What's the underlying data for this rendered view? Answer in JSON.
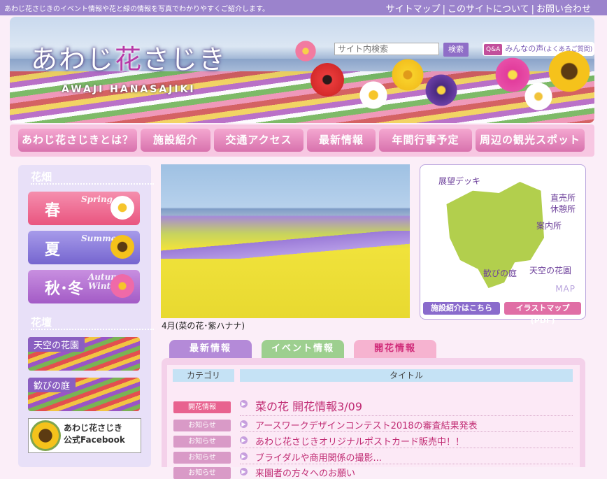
{
  "topbar": {
    "tagline": "あわじ花さじきのイベント情報や花と緑の情報を写真でわかりやすくご紹介します。",
    "links": [
      "サイトマップ",
      "このサイトについて",
      "お問い合わせ"
    ]
  },
  "header": {
    "logo_pre": "あわじ",
    "logo_hana": "花",
    "logo_post": "さじき",
    "logo_en": "AWAJI HANASAJIKI",
    "search_placeholder": "サイト内検索",
    "search_button": "検索",
    "qa_badge": "Q&A",
    "qa_label": "みんなの声",
    "qa_sub": "(よくあるご質問)"
  },
  "nav": [
    "あわじ花さじきとは？",
    "施設紹介",
    "交通アクセス",
    "最新情報",
    "年間行事予定",
    "周辺の観光スポット"
  ],
  "sidebar": {
    "section1": "花畑",
    "seasons": [
      {
        "main": "春",
        "sub": "Spring",
        "color": "#ee6d8e"
      },
      {
        "main": "夏",
        "sub": "Summer",
        "color": "#8b78d8"
      },
      {
        "main": "秋･冬",
        "sub": "Autumn Winter",
        "color": "#b06fd0"
      }
    ],
    "section2": "花壇",
    "beds": [
      "天空の花園",
      "歓びの庭"
    ],
    "facebook_line1": "あわじ花さじき",
    "facebook_line2": "公式Facebook"
  },
  "photo": {
    "caption": "4月(菜の花･紫ハナナ)"
  },
  "map": {
    "labels": [
      "展望デッキ",
      "直売所",
      "休憩所",
      "案内所",
      "歓びの庭",
      "天空の花園"
    ],
    "map_word": "MAP",
    "btn_facility": "施設紹介はこちら",
    "btn_pdf": "イラストマップ(PDF)"
  },
  "tabs": [
    "最新情報",
    "イベント情報",
    "開花情報"
  ],
  "news": {
    "col_category": "カテゴリ",
    "col_title": "タイトル",
    "rows": [
      {
        "category": "開花情報",
        "title": "菜の花 開花情報3/09"
      },
      {
        "category": "お知らせ",
        "title": "アースワークデザインコンテスト2018の審査結果発表"
      },
      {
        "category": "お知らせ",
        "title": "あわじ花さじきオリジナルポストカード販売中！！"
      },
      {
        "category": "お知らせ",
        "title": "ブライダルや商用関係の撮影..."
      },
      {
        "category": "お知らせ",
        "title": "来園者の方々へのお願い"
      }
    ]
  },
  "colors": {
    "accent_purple": "#9b83cc",
    "nav_pink": "#d872ad",
    "badge_bloom": "#e8628f",
    "badge_notice": "#d99ac7"
  }
}
